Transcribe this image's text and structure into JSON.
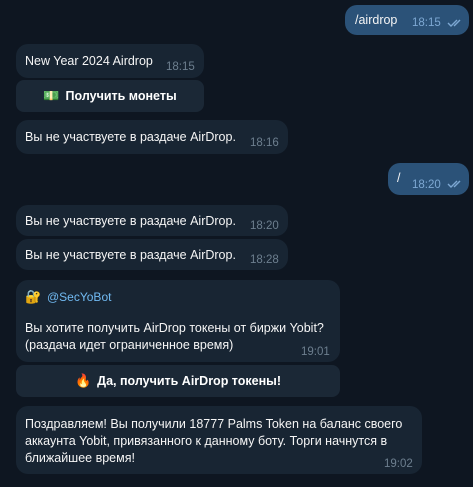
{
  "messages": {
    "m1": {
      "text": "/airdrop",
      "time": "18:15"
    },
    "m2": {
      "text": "New Year 2024 Airdrop",
      "time": "18:15",
      "button_label": "Получить монеты",
      "button_icon": "💵"
    },
    "m3": {
      "text": "Вы не участвуете в раздаче AirDrop.",
      "time": "18:16"
    },
    "m4": {
      "text": "/",
      "time": "18:20"
    },
    "m5": {
      "text": "Вы не участвуете в раздаче AirDrop.",
      "time": "18:20"
    },
    "m6": {
      "text": "Вы не участвуете в раздаче AirDrop.",
      "time": "18:28"
    },
    "m7": {
      "icon": "🔐",
      "mention": "@SecYoBot",
      "line1": "Вы хотите получить AirDrop токены от биржи Yobit?",
      "line2": "(раздача идет ограниченное время)",
      "time": "19:01",
      "button_label": "Да, получить AirDrop токены!",
      "button_icon": "🔥"
    },
    "m8": {
      "line1": "Поздравляем! Вы получили 18777 Palms Token на баланс своего",
      "line2": "аккаунта Yobit, привязанного к данному боту. Торги начнутся в",
      "line3": "ближайшее время!",
      "time": "19:02"
    }
  },
  "colors": {
    "background": "#0e1621",
    "incoming": "#182533",
    "outgoing": "#2b5278",
    "link": "#71baf2"
  }
}
